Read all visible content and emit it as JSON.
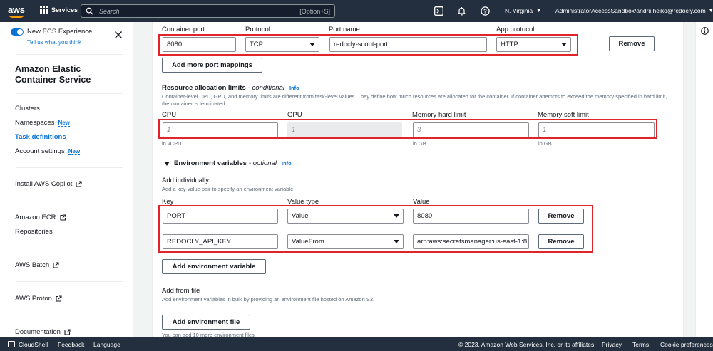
{
  "topnav": {
    "logo": "aws",
    "services_label": "Services",
    "search_placeholder": "Search",
    "search_shortcut": "[Option+S]",
    "region": "N. Virginia",
    "account": "AdministratorAccessSandbox/andrii.heiko@redocly.com"
  },
  "sidebar": {
    "toggle_label": "New ECS Experience",
    "tell_us": "Tell us what you think",
    "title": "Amazon Elastic Container Service",
    "items": [
      {
        "label": "Clusters",
        "badge": ""
      },
      {
        "label": "Namespaces",
        "badge": "New"
      },
      {
        "label": "Task definitions",
        "badge": ""
      },
      {
        "label": "Account settings",
        "badge": "New"
      }
    ],
    "install_copilot": "Install AWS Copilot",
    "ecr": "Amazon ECR",
    "repositories": "Repositories",
    "batch": "AWS Batch",
    "proton": "AWS Proton",
    "documentation": "Documentation"
  },
  "port_mapping": {
    "container_port_label": "Container port",
    "protocol_label": "Protocol",
    "port_name_label": "Port name",
    "app_protocol_label": "App protocol",
    "container_port": "8080",
    "protocol": "TCP",
    "port_name": "redocly-scout-port",
    "app_protocol": "HTTP",
    "remove_label": "Remove",
    "add_more_label": "Add more port mappings"
  },
  "resources": {
    "title": "Resource allocation limits",
    "title_suffix": "- conditional",
    "info": "Info",
    "description": "Container-level CPU, GPU, and memory limits are different from task-level values. They define how much resources are allocated for the container. If container attempts to exceed the memory specified in hard limit, the container is terminated.",
    "cpu_label": "CPU",
    "gpu_label": "GPU",
    "mem_hard_label": "Memory hard limit",
    "mem_soft_label": "Memory soft limit",
    "cpu_placeholder": "1",
    "gpu_placeholder": "1",
    "mem_hard_placeholder": "3",
    "mem_soft_placeholder": "1",
    "cpu_hint": "in vCPU",
    "mem_hard_hint": "in GB",
    "mem_soft_hint": "in GB"
  },
  "env": {
    "title": "Environment variables",
    "title_suffix": "- optional",
    "info": "Info",
    "add_individually": "Add individually",
    "add_individually_desc": "Add a key-value pair to specify an environment variable.",
    "key_label": "Key",
    "value_type_label": "Value type",
    "value_label": "Value",
    "rows": [
      {
        "key": "PORT",
        "value_type": "Value",
        "value": "8080"
      },
      {
        "key": "REDOCLY_API_KEY",
        "value_type": "ValueFrom",
        "value": "arn:aws:secretsmanager:us-east-1:8"
      }
    ],
    "remove_label": "Remove",
    "add_env_var_label": "Add environment variable",
    "add_from_file": "Add from file",
    "add_from_file_desc": "Add environment variables in bulk by providing an environment file hosted on Amazon S3.",
    "add_env_file_label": "Add environment file",
    "file_hint": "You can add 10 more environment files."
  },
  "footer": {
    "cloudshell": "CloudShell",
    "feedback": "Feedback",
    "language": "Language",
    "copyright": "© 2023, Amazon Web Services, Inc. or its affiliates.",
    "privacy": "Privacy",
    "terms": "Terms",
    "cookies": "Cookie preferences"
  }
}
